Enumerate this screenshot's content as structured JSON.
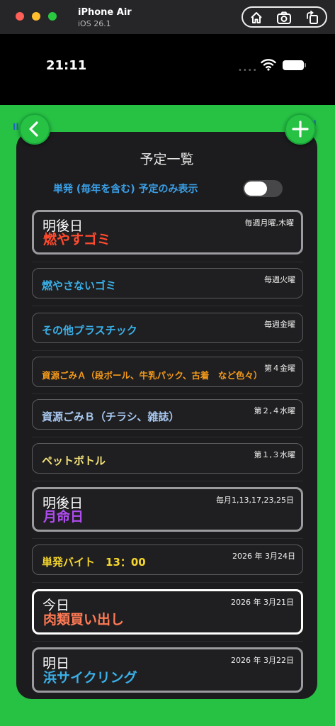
{
  "simulator": {
    "device_name": "iPhone Air",
    "os_version": "iOS 26.1",
    "toolbar_icons": [
      "home-icon",
      "screenshot-icon",
      "rotate-icon"
    ]
  },
  "status_bar": {
    "time": "21:11",
    "dots": "••••"
  },
  "app": {
    "title": "予定一覧",
    "toggle_label": "単発 (毎年を含む) 予定のみ表示",
    "toggle_on": false,
    "back_icon": "chevron-left-icon",
    "add_icon": "plus-icon",
    "ghost_left": "Il(•)",
    "ghost_right": "Il"
  },
  "colors": {
    "app_green": "#27c244",
    "panel": "#1c1c1e",
    "red": "#ff4a2e",
    "cyan": "#3ab0e8",
    "orange": "#f59a1a",
    "light_blue": "#a8c8f0",
    "yellow": "#f5e37a",
    "purple": "#b04cf0",
    "salmon": "#ff7a55",
    "gold": "#f5d62e"
  },
  "items": [
    {
      "top_label": "明後日",
      "rule": "毎週月曜,木曜",
      "name": "燃やすゴミ",
      "color": "#ff4a2e",
      "style": "hl"
    },
    {
      "top_label": "",
      "rule": "毎週火曜",
      "name": "燃やさないゴミ",
      "color": "#3ab0e8",
      "style": "normal"
    },
    {
      "top_label": "",
      "rule": "毎週金曜",
      "name": "その他プラスチック",
      "color": "#3ab0e8",
      "style": "normal"
    },
    {
      "top_label": "",
      "rule": "第４金曜",
      "name": "資源ごみＡ（段ボール、牛乳パック、古着　など色々）",
      "color": "#f59a1a",
      "style": "normal"
    },
    {
      "top_label": "",
      "rule": "第２,４水曜",
      "name": "資源ごみＢ（チラシ、雑誌）",
      "color": "#a8c8f0",
      "style": "normal"
    },
    {
      "top_label": "",
      "rule": "第１,３水曜",
      "name": "ペットボトル",
      "color": "#f5e37a",
      "style": "normal"
    },
    {
      "top_label": "明後日",
      "rule": "毎月1,13,17,23,25日",
      "name": "月命日",
      "color": "#b04cf0",
      "style": "hl"
    },
    {
      "top_label": "",
      "rule": "2026 年 3月24日",
      "name": "単発バイト　13：00",
      "color": "#f5d62e",
      "style": "normal"
    },
    {
      "top_label": "今日",
      "rule": "2026 年 3月21日",
      "name": "肉類買い出し",
      "color": "#ff7a55",
      "style": "today"
    },
    {
      "top_label": "明日",
      "rule": "2026 年 3月22日",
      "name": "浜サイクリング",
      "color": "#3ab0e8",
      "style": "hl"
    }
  ]
}
